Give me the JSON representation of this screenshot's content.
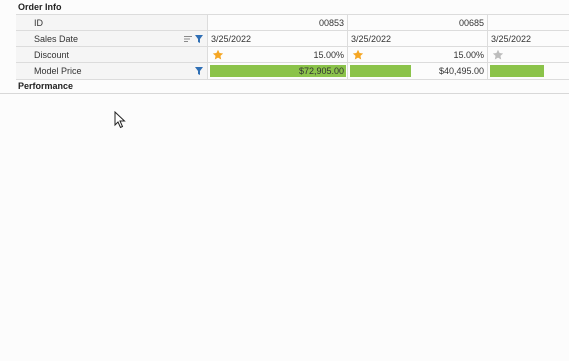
{
  "categories": {
    "order_info": "Order Info",
    "performance": "Performance"
  },
  "rows": {
    "id": {
      "label": "ID",
      "values": [
        "00853",
        "00685",
        ""
      ]
    },
    "sales_date": {
      "label": "Sales Date",
      "values": [
        "3/25/2022",
        "3/25/2022",
        "3/25/2022"
      ]
    },
    "discount": {
      "label": "Discount",
      "values": [
        "15.00%",
        "15.00%",
        ""
      ],
      "stars": [
        "filled",
        "filled",
        "empty"
      ]
    },
    "model_price": {
      "label": "Model Price",
      "values": [
        "$72,905.00",
        "$40,495.00",
        ""
      ],
      "bar_fraction": [
        1.0,
        0.45,
        0.85
      ]
    }
  },
  "colors": {
    "bar": "#8bc34a",
    "star_filled": "#f5a623",
    "star_empty": "#bdbdbd",
    "filter_icon": "#2f6fb5"
  }
}
